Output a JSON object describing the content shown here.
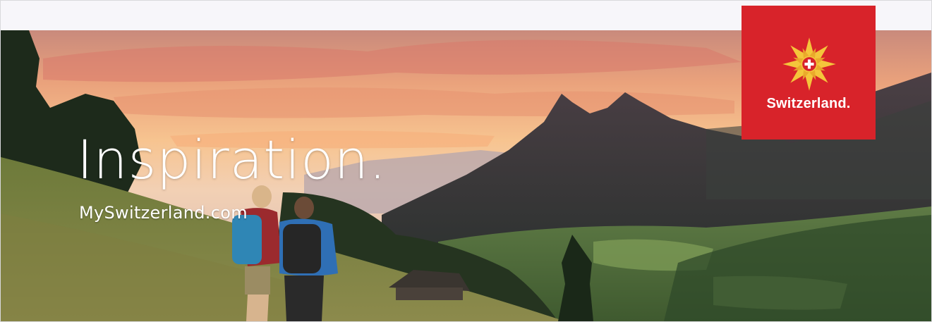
{
  "banner": {
    "headline": "Inspiration.",
    "site": "MySwitzerland.com"
  },
  "logo": {
    "wordmark": "Switzerland.",
    "background_color": "#d8232a",
    "icon": "swiss-edelweiss-cross-icon"
  },
  "colors": {
    "sky_orange": "#f3a06a",
    "sky_pink": "#e8b9a8",
    "text": "#ffffff"
  }
}
